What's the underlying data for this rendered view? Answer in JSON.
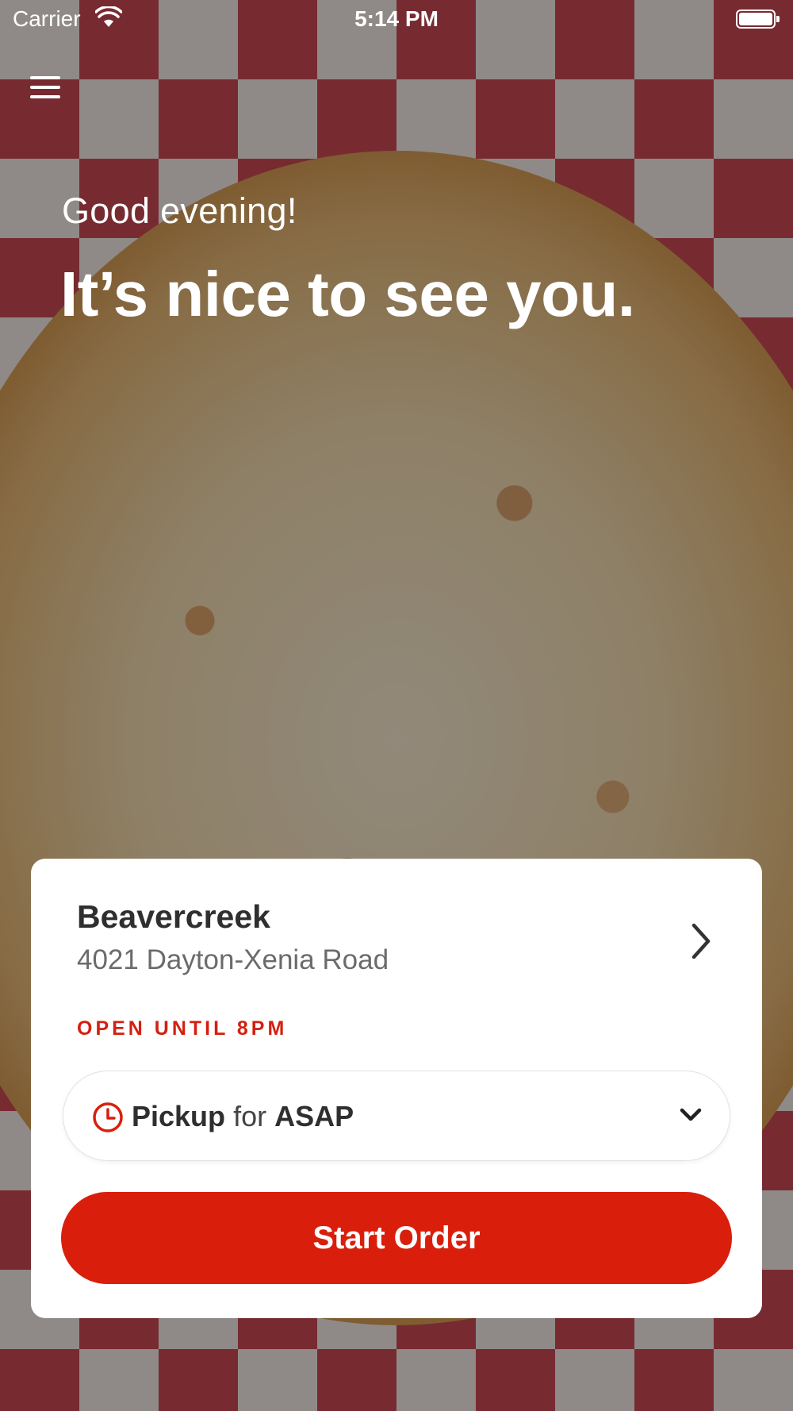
{
  "status_bar": {
    "carrier": "Carrier",
    "time": "5:14 PM"
  },
  "header": {
    "menu_icon": "hamburger-menu-icon"
  },
  "greeting": {
    "salutation": "Good evening!",
    "headline": "It’s nice to see you."
  },
  "location_card": {
    "name": "Beavercreek",
    "address": "4021 Dayton-Xenia Road",
    "hours": "OPEN UNTIL 8PM",
    "order_type": {
      "mode": "Pickup",
      "connector": "for",
      "time": "ASAP"
    },
    "start_order_label": "Start Order"
  },
  "colors": {
    "accent": "#d91f0c",
    "hours_text": "#d41f10",
    "card_background": "#ffffff"
  }
}
